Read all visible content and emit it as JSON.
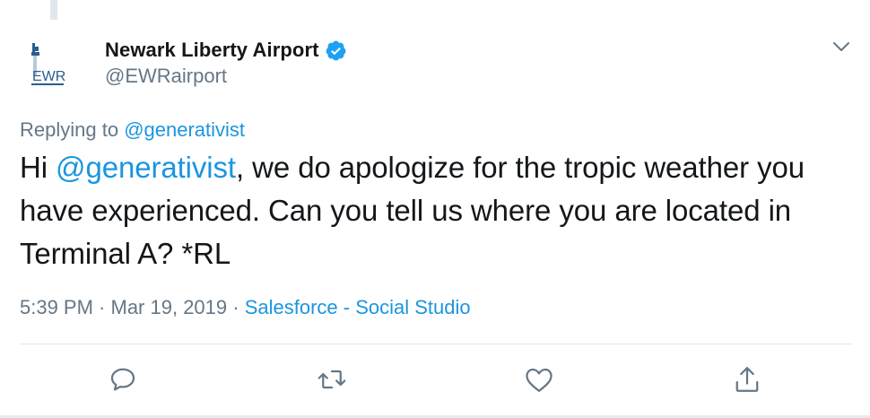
{
  "tweet": {
    "author": {
      "display_name": "Newark Liberty Airport",
      "handle": "@EWRairport",
      "avatar_text": "EWR",
      "verified": true
    },
    "replying_to": {
      "prefix": "Replying to",
      "mention": "@generativist"
    },
    "text": {
      "greeting": "Hi ",
      "mention": "@generativist",
      "body": ", we do apologize for the tropic weather you have experienced. Can you tell us where you are located in Terminal A? *RL"
    },
    "meta": {
      "time": "5:39 PM",
      "separator_1": " · ",
      "date": "Mar 19, 2019",
      "separator_2": " · ",
      "source": "Salesforce - Social Studio"
    },
    "actions": [
      {
        "name": "reply",
        "icon": "speech-bubble-icon"
      },
      {
        "name": "retweet",
        "icon": "retweet-icon"
      },
      {
        "name": "like",
        "icon": "heart-icon"
      },
      {
        "name": "share",
        "icon": "share-icon"
      }
    ]
  },
  "colors": {
    "text": "#14171a",
    "secondary": "#657786",
    "link": "#1b95e0",
    "divider": "#e1e8ed",
    "verified": "#1da1f2",
    "logo_blue": "#2a5d8f"
  }
}
